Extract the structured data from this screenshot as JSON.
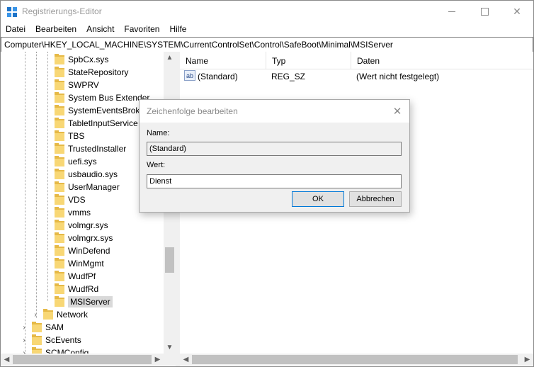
{
  "window": {
    "title": "Registrierungs-Editor",
    "controls": {
      "minimize": "minimize",
      "maximize": "maximize",
      "close": "✕"
    }
  },
  "menu": [
    "Datei",
    "Bearbeiten",
    "Ansicht",
    "Favoriten",
    "Hilfe"
  ],
  "address": "Computer\\HKEY_LOCAL_MACHINE\\SYSTEM\\CurrentControlSet\\Control\\SafeBoot\\Minimal\\MSIServer",
  "tree": {
    "items": [
      "SpbCx.sys",
      "StateRepository",
      "SWPRV",
      "System Bus Extender",
      "SystemEventsBroker",
      "TabletInputService",
      "TBS",
      "TrustedInstaller",
      "uefi.sys",
      "usbaudio.sys",
      "UserManager",
      "VDS",
      "vmms",
      "volmgr.sys",
      "volmgrx.sys",
      "WinDefend",
      "WinMgmt",
      "WudfPf",
      "WudfRd",
      "MSIServer"
    ],
    "selected": "MSIServer",
    "parent_items": [
      "Network"
    ],
    "root_items": [
      "SAM",
      "ScEvents",
      "SCMConfig"
    ],
    "collapsed_glyph": "›"
  },
  "list": {
    "columns": [
      "Name",
      "Typ",
      "Daten"
    ],
    "rows": [
      {
        "icon": "ab",
        "name": "(Standard)",
        "type": "REG_SZ",
        "data": "(Wert nicht festgelegt)"
      }
    ]
  },
  "dialog": {
    "title": "Zeichenfolge bearbeiten",
    "close": "✕",
    "name_label": "Name:",
    "name_value": "(Standard)",
    "value_label": "Wert:",
    "value_value": "Dienst",
    "ok": "OK",
    "cancel": "Abbrechen"
  },
  "scroll": {
    "up": "▲",
    "down": "▼",
    "left": "◀",
    "right": "▶",
    "tree_thumb_fraction": 0.62
  },
  "colors": {
    "folder": "#f8d775",
    "selection": "#d9d9d9",
    "accent": "#0078d7"
  }
}
